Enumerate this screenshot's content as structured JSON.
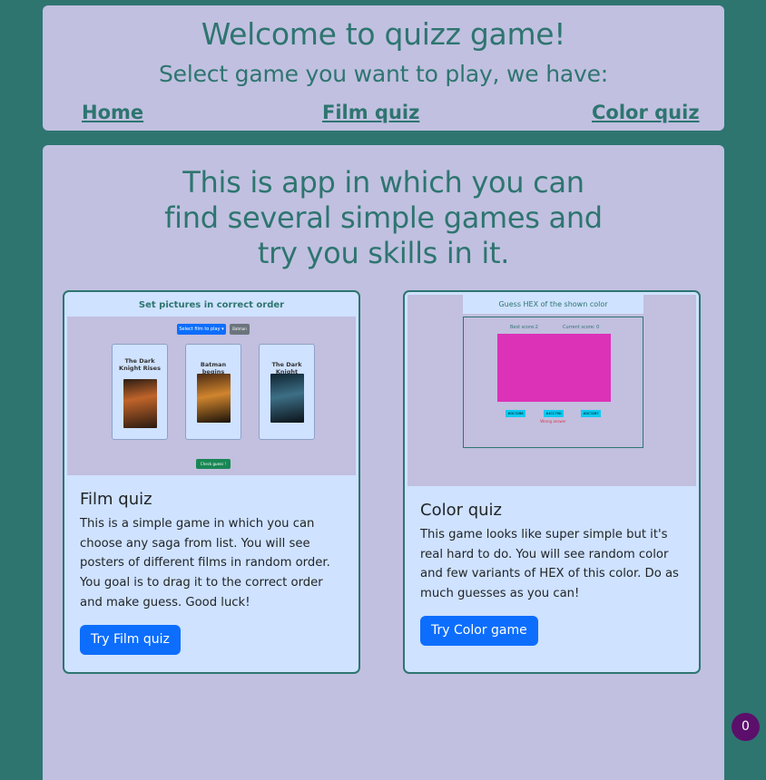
{
  "header": {
    "title": "Welcome to quizz game!",
    "subtitle": "Select game you want to play, we have:",
    "nav": [
      {
        "label": "Home"
      },
      {
        "label": "Film quiz"
      },
      {
        "label": "Color quiz"
      }
    ]
  },
  "intro": {
    "lines": [
      "This is app in which you can",
      "find several simple games and",
      "try you skills in it."
    ]
  },
  "cards": [
    {
      "title": "Film quiz",
      "text": "This is a simple game in which you can choose any saga from list. You will see posters of different films in random order. You goal is to drag it to the correct order and make guess. Good luck!",
      "button": "Try Film quiz",
      "preview": {
        "heading": "Set pictures in correct order",
        "select_label": "Select film to play",
        "small_button": "Batman",
        "posters": [
          {
            "title": "The Dark Knight Rises"
          },
          {
            "title": "Batman begins"
          },
          {
            "title": "The Dark Knight"
          }
        ],
        "check_button": "Check guess !"
      }
    },
    {
      "title": "Color quiz",
      "text": "This game looks like super simple but it's real hard to do. You will see random color and few variants of HEX of this color. Do as much guesses as you can!",
      "button": "Try Color game",
      "preview": {
        "heading": "Guess HEX of the shown color",
        "best_score": "Best score:2",
        "current_score": "Current score: 0",
        "swatch_color": "#dc32b8",
        "options": [
          "#DC32B8",
          "#4CC79D",
          "#DC32B7"
        ],
        "wrong_text": "Wrong answer"
      }
    }
  ],
  "badge": {
    "count": "0"
  },
  "colors": {
    "accent": "#2e7570",
    "panel": "#c1c0e0",
    "card": "#cfe2ff",
    "button": "#0d6efd",
    "badge": "#5b0f6b"
  }
}
